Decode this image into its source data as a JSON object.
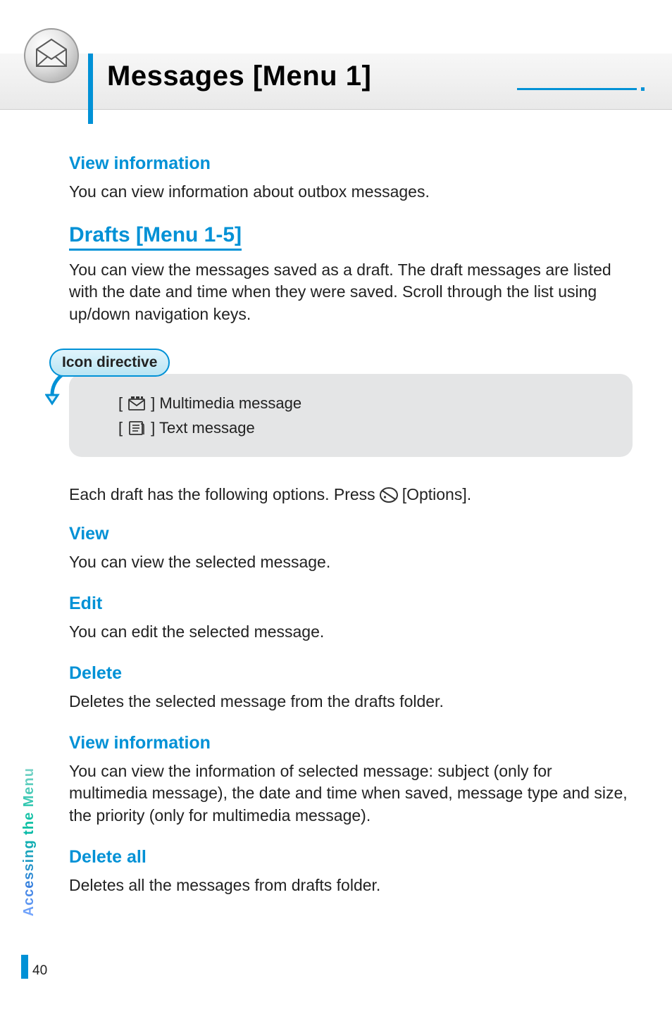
{
  "header": {
    "title": "Messages [Menu 1]"
  },
  "sections": {
    "view_info_top": {
      "heading": "View information",
      "body": "You can view information about outbox messages."
    },
    "drafts": {
      "heading": "Drafts [Menu 1-5]",
      "body": "You can view the messages saved as a draft. The draft messages are listed with the date and time when they were saved. Scroll through the list using up/down navigation keys."
    },
    "callout": {
      "label": "Icon directive",
      "row1_prefix": "[",
      "row1_suffix": "] Multimedia message",
      "row2_prefix": "[",
      "row2_suffix": "] Text message"
    },
    "options_line": {
      "prefix": "Each draft has the following options. Press",
      "suffix": "[Options]."
    },
    "view": {
      "heading": "View",
      "body": "You can view the selected message."
    },
    "edit": {
      "heading": "Edit",
      "body": "You can edit the selected message."
    },
    "delete": {
      "heading": "Delete",
      "body": "Deletes the selected message from the drafts folder."
    },
    "view_info_bottom": {
      "heading": "View information",
      "body": "You can view the information of selected message: subject (only for multimedia message), the date and time when saved, message type and size, the priority (only for multimedia message)."
    },
    "delete_all": {
      "heading": "Delete all",
      "body": "Deletes all the messages from drafts folder."
    }
  },
  "side": {
    "label": "Accessing the Menu",
    "page": "40"
  }
}
